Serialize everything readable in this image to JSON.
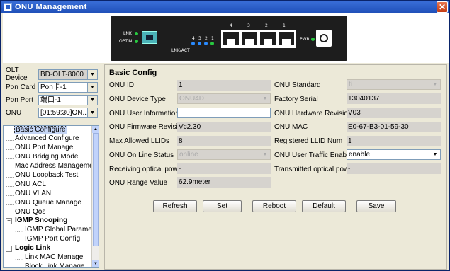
{
  "window": {
    "title": "ONU Management",
    "close_label": "✕"
  },
  "device": {
    "led_lnk": "LNK",
    "led_optin": "OPTIN",
    "lnk_act": "LNK/ACT",
    "port_numbers_small": [
      "4",
      "3",
      "2",
      "1"
    ],
    "port_numbers_large": [
      "4",
      "3",
      "2",
      "1"
    ],
    "pwr": "PWR"
  },
  "left": {
    "olt_device": {
      "label": "OLT Device",
      "value": "BD-OLT-8000"
    },
    "pon_card": {
      "label": "Pon Card",
      "value": "Pon卡-1"
    },
    "pon_port": {
      "label": "Pon Port",
      "value": "端口-1"
    },
    "onu": {
      "label": "ONU",
      "value": "[01:59:30]ON..."
    },
    "tree": {
      "items": [
        "Basic Configure",
        "Advanced Configure",
        "ONU Port Manage",
        "ONU Bridging Mode",
        "Mac Address Management",
        "ONU Loopback Test",
        "ONU ACL",
        "ONU VLAN",
        "ONU Queue Manage",
        "ONU Qos"
      ],
      "groups": [
        {
          "label": "IGMP Snooping",
          "children": [
            "IGMP Global Parameter",
            "IGMP Port Config"
          ]
        },
        {
          "label": "Logic Link",
          "children": [
            "Link MAC Manage",
            "Block Link Manage"
          ]
        }
      ]
    }
  },
  "main": {
    "section_title": "Basic Config",
    "fields_left": [
      {
        "label": "ONU ID",
        "value": "1"
      },
      {
        "label": "ONU Device Type",
        "value": "ONU4D"
      },
      {
        "label": "ONU User Information",
        "value": ""
      },
      {
        "label": "ONU Firmware Revision",
        "value": "Vc2.30"
      },
      {
        "label": "Max Allowed LLIDs",
        "value": "8"
      },
      {
        "label": "ONU On Line Status",
        "value": "online"
      },
      {
        "label": "Receiving optical power",
        "value": "-"
      },
      {
        "label": "ONU Range Value",
        "value": "62.9meter"
      }
    ],
    "fields_right": [
      {
        "label": "ONU Standard",
        "value": "ti"
      },
      {
        "label": "Factory Serial",
        "value": "13040137"
      },
      {
        "label": "ONU Hardware Revision",
        "value": "V03"
      },
      {
        "label": "ONU  MAC",
        "value": "E0-67-B3-01-59-30"
      },
      {
        "label": "Registered LLID Num",
        "value": "1"
      },
      {
        "label": "ONU User Traffic Enable",
        "value": "enable"
      },
      {
        "label": "Transmitted optical power",
        "value": "-"
      }
    ],
    "buttons": {
      "refresh": "Refresh",
      "set": "Set",
      "reboot": "Reboot",
      "default": "Default",
      "save": "Save"
    }
  }
}
